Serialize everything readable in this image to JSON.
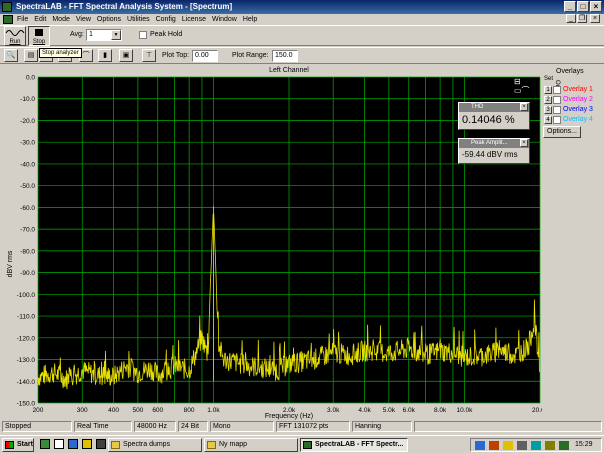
{
  "window": {
    "title": "SpectraLAB - FFT Spectral Analysis System - [Spectrum]",
    "controls": {
      "minimize": "_",
      "maximize": "□",
      "close": "×"
    },
    "mdi_controls": {
      "minimize": "_",
      "restore": "❐",
      "close": "×"
    }
  },
  "menu": [
    "File",
    "Edit",
    "Mode",
    "View",
    "Options",
    "Utilities",
    "Config",
    "License",
    "Window",
    "Help"
  ],
  "toolbar1": {
    "run_label": "Run",
    "stop_label": "Stop",
    "avg_label": "Avg:",
    "avg_value": "1",
    "peak_hold_label": "Peak Hold"
  },
  "toolbar2": {
    "plot_top_label": "Plot Top:",
    "plot_top_value": "0.00",
    "plot_range_label": "Plot Range:",
    "plot_range_value": "150.0"
  },
  "tooltip": "Stop analyzer",
  "overlays": {
    "title": "Overlays",
    "set_label": "Set",
    "on_label": "On",
    "items": [
      {
        "num": "1",
        "label": "Overlay 1",
        "color": "#ff0000"
      },
      {
        "num": "2",
        "label": "Overlay 2",
        "color": "#ff00ff"
      },
      {
        "num": "3",
        "label": "Overlay 3",
        "color": "#0000ff"
      },
      {
        "num": "4",
        "label": "Overlay 4",
        "color": "#00c0ff"
      }
    ],
    "options_button": "Options..."
  },
  "thd_panel": {
    "title": "THD",
    "value": "0.14046 %"
  },
  "peak_panel": {
    "title": "Peak Amplit...",
    "value": "-59.44 dBV rms"
  },
  "statusbar": {
    "state": "Stopped",
    "mode": "Real Time",
    "rate": "48000 Hz",
    "bits": "24 Bit",
    "channels": "Mono",
    "fft": "FFT 131072 pts",
    "window": "Hanning"
  },
  "taskbar": {
    "start": "Start",
    "tasks": [
      "Spectra dumps",
      "Ny mapp",
      "SpectraLAB - FFT Spectr..."
    ],
    "clock": "15:29"
  },
  "colors": {
    "plot_background": "#000000",
    "grid": "#00b000",
    "trace": "#e8e000",
    "title_bar": "#0a246a"
  },
  "chart_data": {
    "type": "line",
    "title": "Left Channel",
    "xlabel": "Frequency (Hz)",
    "ylabel": "dBV rms",
    "x_scale": "log",
    "xlim": [
      200,
      20000
    ],
    "ylim": [
      -150,
      0
    ],
    "grid": true,
    "x_ticks": [
      200,
      300,
      400,
      500,
      600,
      800,
      1000,
      2000,
      3000,
      4000,
      5000,
      6000,
      8000,
      10000,
      20000
    ],
    "x_tick_labels": [
      "200",
      "300",
      "400",
      "500",
      "600",
      "800",
      "1.0k",
      "2.0k",
      "3.0k",
      "4.0k",
      "5.0k",
      "6.0k",
      "8.0k",
      "10.0k",
      "20.0k"
    ],
    "y_ticks": [
      0,
      -10,
      -20,
      -30,
      -40,
      -50,
      -60,
      -70,
      -80,
      -90,
      -100,
      -110,
      -120,
      -130,
      -140,
      -150
    ],
    "y_tick_labels": [
      "0.0",
      "-10.0",
      "-20.0",
      "-30.0",
      "-40.0",
      "-50.0",
      "-60.0",
      "-70.0",
      "-80.0",
      "-90.0",
      "-100.0",
      "-110.0",
      "-120.0",
      "-130.0",
      "-140.0",
      "-150.0"
    ],
    "series": [
      {
        "color": "#e8e000",
        "x": [
          200,
          230,
          260,
          300,
          340,
          400,
          450,
          500,
          560,
          600,
          700,
          800,
          900,
          950,
          1000,
          1050,
          1100,
          1200,
          1400,
          1600,
          1800,
          2000,
          2500,
          3000,
          3500,
          4000,
          5000,
          6000,
          7000,
          8000,
          9000,
          10000,
          12000,
          14000,
          16000,
          18000,
          19000,
          20000
        ],
        "y": [
          -138,
          -136,
          -139,
          -135,
          -137,
          -138,
          -133,
          -136,
          -134,
          -137,
          -133,
          -135,
          -120,
          -128,
          -59.44,
          -124,
          -130,
          -131,
          -133,
          -134,
          -135,
          -132,
          -130,
          -127,
          -128,
          -126,
          -127,
          -125,
          -128,
          -126,
          -127,
          -129,
          -128,
          -126,
          -128,
          -124,
          -112,
          -135
        ],
        "noise_floor": [
          -140,
          -128
        ]
      }
    ]
  }
}
